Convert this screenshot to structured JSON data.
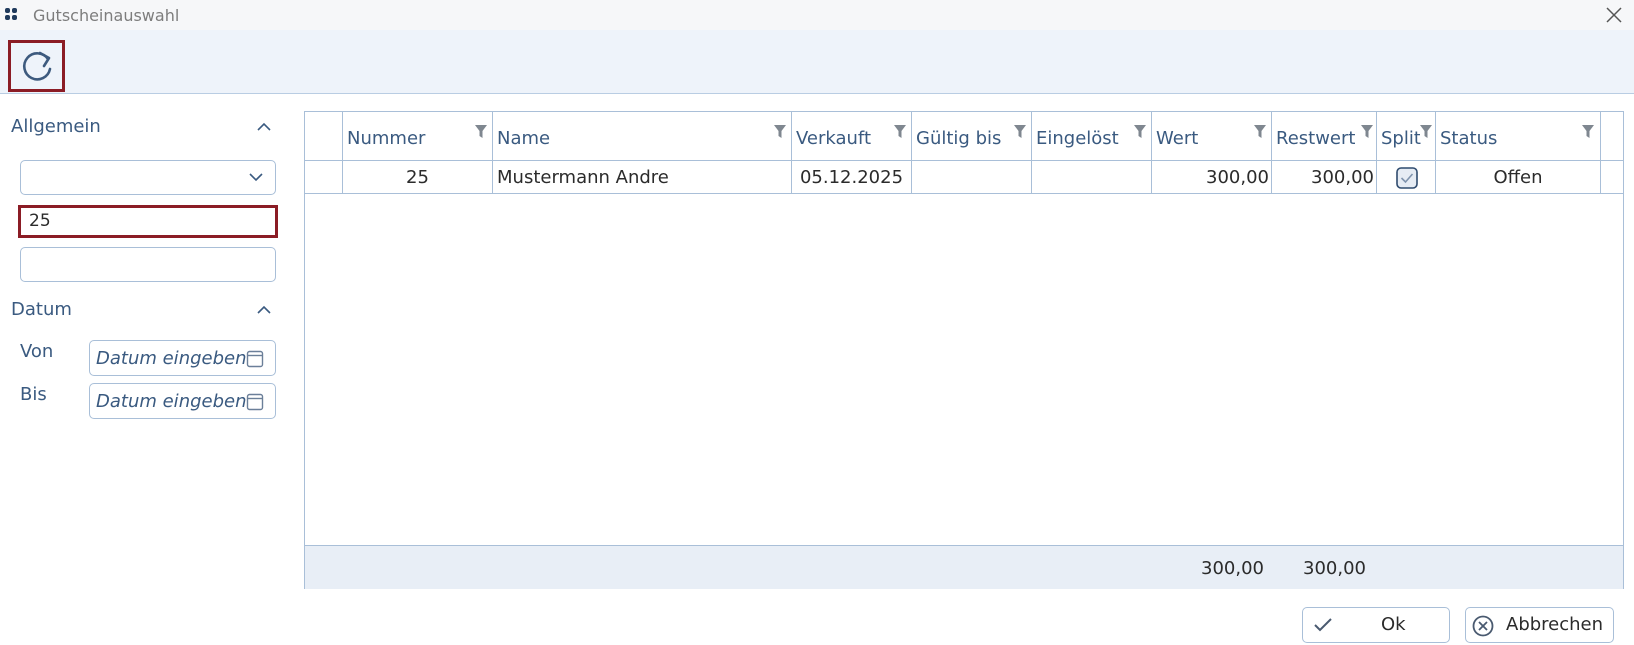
{
  "window": {
    "title": "Gutscheinauswahl"
  },
  "toolbar": {
    "refresh_icon": "refresh-icon"
  },
  "filters": {
    "general_header": "Allgemein",
    "dropdown_value": "",
    "number_value": "25",
    "extra_value": "",
    "date_header": "Datum",
    "from_label": "Von",
    "to_label": "Bis",
    "date_placeholder": "Datum eingeben"
  },
  "grid": {
    "columns": [
      "Nummer",
      "Name",
      "Verkauft",
      "Gültig bis",
      "Eingelöst",
      "Wert",
      "Restwert",
      "Split",
      "Status"
    ],
    "rows": [
      {
        "nummer": "25",
        "name": "Mustermann Andre",
        "verkauft": "05.12.2025",
        "gueltig_bis": "",
        "eingeloest": "",
        "wert": "300,00",
        "restwert": "300,00",
        "split": true,
        "status": "Offen"
      }
    ],
    "footer": {
      "wert_sum": "300,00",
      "restwert_sum": "300,00"
    }
  },
  "buttons": {
    "ok": "Ok",
    "cancel": "Abbrechen"
  },
  "colors": {
    "accent_border": "#8b1c25",
    "label_blue": "#3a5a80",
    "grid_border": "#a9bfd8"
  }
}
